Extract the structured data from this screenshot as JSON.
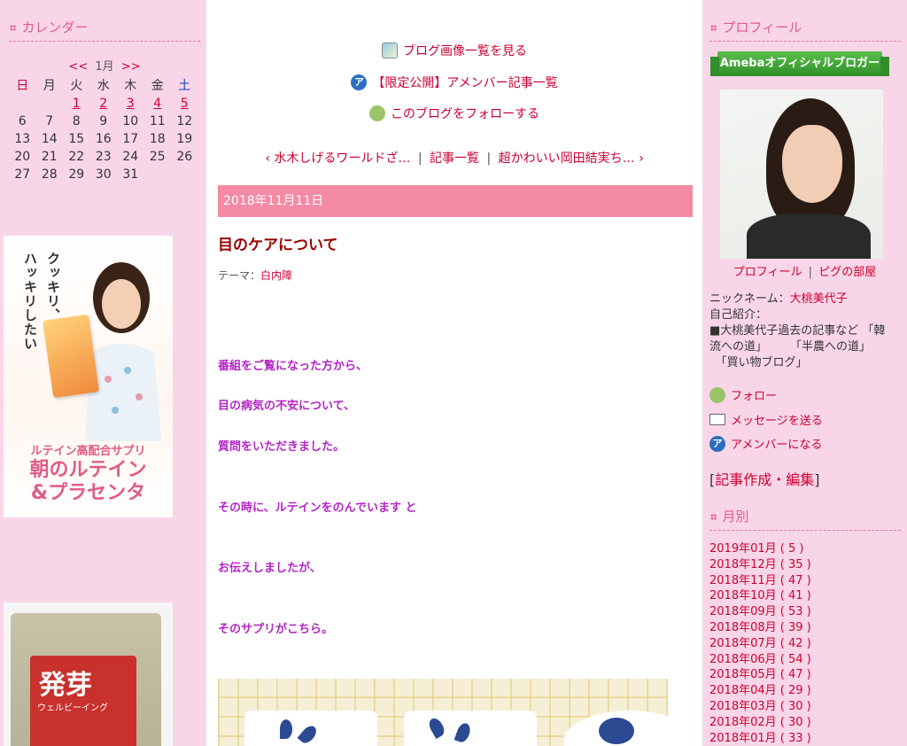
{
  "left": {
    "calendar_title": "カレンダー",
    "calendar": {
      "prev": "<<",
      "month": "1月",
      "next": ">>",
      "weekdays": [
        "日",
        "月",
        "火",
        "水",
        "木",
        "金",
        "土"
      ],
      "rows": [
        [
          "",
          "",
          "1",
          "2",
          "3",
          "4",
          "5"
        ],
        [
          "6",
          "7",
          "8",
          "9",
          "10",
          "11",
          "12"
        ],
        [
          "13",
          "14",
          "15",
          "16",
          "17",
          "18",
          "19"
        ],
        [
          "20",
          "21",
          "22",
          "23",
          "24",
          "25",
          "26"
        ],
        [
          "27",
          "28",
          "29",
          "30",
          "31",
          "",
          ""
        ]
      ],
      "linked_days": [
        "1",
        "2",
        "3",
        "4",
        "5"
      ]
    },
    "banner1": {
      "vtext1": "クッキリ、",
      "vtext2": "ハッキリしたい",
      "line1": "ルテイン高配合サプリ",
      "line2": "朝のルテイン",
      "line3": "&プラセンタ"
    },
    "banner2": {
      "big": "発芽",
      "sub": "ウェルビーイング"
    }
  },
  "main": {
    "links": {
      "image_list": "ブログ画像一覧を見る",
      "limited": "【限定公開】アメンバー記事一覧",
      "follow": "このブログをフォローする"
    },
    "nav": {
      "prev": "‹ 水木しげるワールドざ…",
      "list": "記事一覧",
      "next": "超かわいい岡田結実ち… ›"
    },
    "date": "2018年11月11日",
    "title": "目のケアについて",
    "theme_label": "テーマ：",
    "theme_value": "白内障",
    "paragraphs": [
      "番組をご覧になった方から、",
      "目の病気の不安について、",
      "質問をいただきました。",
      "その時に、ルテインをのんでいます と",
      "お伝えしましたが、",
      "そのサプリがこちら。"
    ]
  },
  "right": {
    "profile_title": "プロフィール",
    "badge": "Amebaオフィシャルブロガー",
    "profile_link": "プロフィール",
    "room_link": "ピグの部屋",
    "nickname_label": "ニックネーム：",
    "nickname": "大桃美代子",
    "intro_label": "自己紹介：",
    "intro_line1": "■大桃美代子過去の記事など 「韓",
    "intro_line2": "流への道」　　　「半農への道」",
    "intro_line3": "　「買い物ブログ」",
    "follow": "フォロー",
    "message": "メッセージを送る",
    "amember": "アメンバーになる",
    "edit_open": "[",
    "edit": "記事作成・編集",
    "edit_close": "]",
    "monthly_title": "月別",
    "months": [
      "2019年01月 ( 5 )",
      "2018年12月 ( 35 )",
      "2018年11月 ( 47 )",
      "2018年10月 ( 41 )",
      "2018年09月 ( 53 )",
      "2018年08月 ( 39 )",
      "2018年07月 ( 42 )",
      "2018年06月 ( 54 )",
      "2018年05月 ( 47 )",
      "2018年04月 ( 29 )",
      "2018年03月 ( 30 )",
      "2018年02月 ( 30 )",
      "2018年01月 ( 33 )"
    ]
  }
}
